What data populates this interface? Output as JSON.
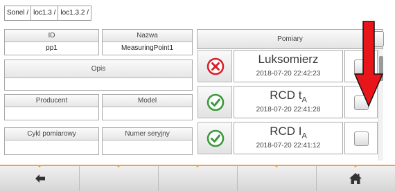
{
  "breadcrumb": [
    "Sonel /",
    "loc1.3 /",
    "loc1.3.2 /"
  ],
  "fields": {
    "id": {
      "label": "ID",
      "value": "pp1"
    },
    "nazwa": {
      "label": "Nazwa",
      "value": "MeasuringPoint1"
    },
    "opis": {
      "label": "Opis",
      "value": ""
    },
    "producent": {
      "label": "Producent",
      "value": ""
    },
    "model": {
      "label": "Model",
      "value": ""
    },
    "cykl": {
      "label": "Cykl pomiarowy",
      "value": ""
    },
    "numer": {
      "label": "Numer seryjny",
      "value": ""
    }
  },
  "measurements": {
    "header": "Pomiary",
    "rows": [
      {
        "name": "Luksomierz",
        "sub": "",
        "date": "2018-07-20 22:42:23",
        "status": "error",
        "checked": false
      },
      {
        "name": "RCD t",
        "sub": "A",
        "date": "2018-07-20 22:41:28",
        "status": "ok",
        "checked": false
      },
      {
        "name": "RCD I",
        "sub": "A",
        "date": "2018-07-20 22:41:12",
        "status": "ok",
        "checked": false
      }
    ]
  },
  "colors": {
    "accent": "#f0a040",
    "error": "#d9202a",
    "ok": "#3a9a3a",
    "arrow": "#e8161b"
  },
  "bottom_bar": {
    "left_icon": "back-arrow-icon",
    "right_icon": "home-icon"
  }
}
